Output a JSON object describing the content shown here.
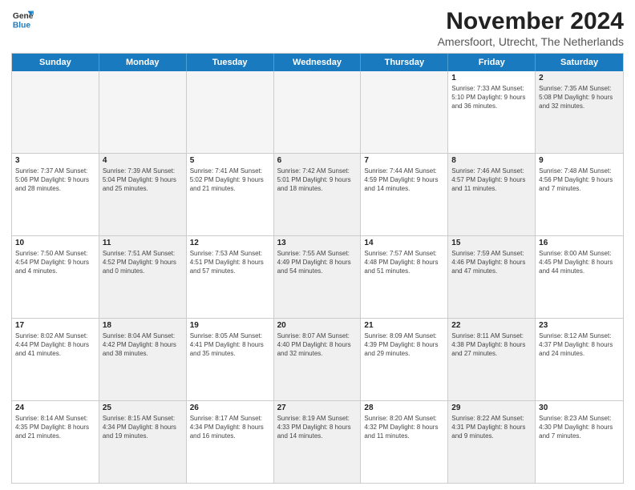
{
  "header": {
    "logo_line1": "General",
    "logo_line2": "Blue",
    "title": "November 2024",
    "subtitle": "Amersfoort, Utrecht, The Netherlands"
  },
  "weekdays": [
    "Sunday",
    "Monday",
    "Tuesday",
    "Wednesday",
    "Thursday",
    "Friday",
    "Saturday"
  ],
  "weeks": [
    [
      {
        "day": "",
        "info": "",
        "shaded": true
      },
      {
        "day": "",
        "info": "",
        "shaded": true
      },
      {
        "day": "",
        "info": "",
        "shaded": true
      },
      {
        "day": "",
        "info": "",
        "shaded": true
      },
      {
        "day": "",
        "info": "",
        "shaded": true
      },
      {
        "day": "1",
        "info": "Sunrise: 7:33 AM\nSunset: 5:10 PM\nDaylight: 9 hours and 36 minutes."
      },
      {
        "day": "2",
        "info": "Sunrise: 7:35 AM\nSunset: 5:08 PM\nDaylight: 9 hours and 32 minutes.",
        "shaded": true
      }
    ],
    [
      {
        "day": "3",
        "info": "Sunrise: 7:37 AM\nSunset: 5:06 PM\nDaylight: 9 hours and 28 minutes."
      },
      {
        "day": "4",
        "info": "Sunrise: 7:39 AM\nSunset: 5:04 PM\nDaylight: 9 hours and 25 minutes.",
        "shaded": true
      },
      {
        "day": "5",
        "info": "Sunrise: 7:41 AM\nSunset: 5:02 PM\nDaylight: 9 hours and 21 minutes."
      },
      {
        "day": "6",
        "info": "Sunrise: 7:42 AM\nSunset: 5:01 PM\nDaylight: 9 hours and 18 minutes.",
        "shaded": true
      },
      {
        "day": "7",
        "info": "Sunrise: 7:44 AM\nSunset: 4:59 PM\nDaylight: 9 hours and 14 minutes."
      },
      {
        "day": "8",
        "info": "Sunrise: 7:46 AM\nSunset: 4:57 PM\nDaylight: 9 hours and 11 minutes.",
        "shaded": true
      },
      {
        "day": "9",
        "info": "Sunrise: 7:48 AM\nSunset: 4:56 PM\nDaylight: 9 hours and 7 minutes."
      }
    ],
    [
      {
        "day": "10",
        "info": "Sunrise: 7:50 AM\nSunset: 4:54 PM\nDaylight: 9 hours and 4 minutes."
      },
      {
        "day": "11",
        "info": "Sunrise: 7:51 AM\nSunset: 4:52 PM\nDaylight: 9 hours and 0 minutes.",
        "shaded": true
      },
      {
        "day": "12",
        "info": "Sunrise: 7:53 AM\nSunset: 4:51 PM\nDaylight: 8 hours and 57 minutes."
      },
      {
        "day": "13",
        "info": "Sunrise: 7:55 AM\nSunset: 4:49 PM\nDaylight: 8 hours and 54 minutes.",
        "shaded": true
      },
      {
        "day": "14",
        "info": "Sunrise: 7:57 AM\nSunset: 4:48 PM\nDaylight: 8 hours and 51 minutes."
      },
      {
        "day": "15",
        "info": "Sunrise: 7:59 AM\nSunset: 4:46 PM\nDaylight: 8 hours and 47 minutes.",
        "shaded": true
      },
      {
        "day": "16",
        "info": "Sunrise: 8:00 AM\nSunset: 4:45 PM\nDaylight: 8 hours and 44 minutes."
      }
    ],
    [
      {
        "day": "17",
        "info": "Sunrise: 8:02 AM\nSunset: 4:44 PM\nDaylight: 8 hours and 41 minutes."
      },
      {
        "day": "18",
        "info": "Sunrise: 8:04 AM\nSunset: 4:42 PM\nDaylight: 8 hours and 38 minutes.",
        "shaded": true
      },
      {
        "day": "19",
        "info": "Sunrise: 8:05 AM\nSunset: 4:41 PM\nDaylight: 8 hours and 35 minutes."
      },
      {
        "day": "20",
        "info": "Sunrise: 8:07 AM\nSunset: 4:40 PM\nDaylight: 8 hours and 32 minutes.",
        "shaded": true
      },
      {
        "day": "21",
        "info": "Sunrise: 8:09 AM\nSunset: 4:39 PM\nDaylight: 8 hours and 29 minutes."
      },
      {
        "day": "22",
        "info": "Sunrise: 8:11 AM\nSunset: 4:38 PM\nDaylight: 8 hours and 27 minutes.",
        "shaded": true
      },
      {
        "day": "23",
        "info": "Sunrise: 8:12 AM\nSunset: 4:37 PM\nDaylight: 8 hours and 24 minutes."
      }
    ],
    [
      {
        "day": "24",
        "info": "Sunrise: 8:14 AM\nSunset: 4:35 PM\nDaylight: 8 hours and 21 minutes."
      },
      {
        "day": "25",
        "info": "Sunrise: 8:15 AM\nSunset: 4:34 PM\nDaylight: 8 hours and 19 minutes.",
        "shaded": true
      },
      {
        "day": "26",
        "info": "Sunrise: 8:17 AM\nSunset: 4:34 PM\nDaylight: 8 hours and 16 minutes."
      },
      {
        "day": "27",
        "info": "Sunrise: 8:19 AM\nSunset: 4:33 PM\nDaylight: 8 hours and 14 minutes.",
        "shaded": true
      },
      {
        "day": "28",
        "info": "Sunrise: 8:20 AM\nSunset: 4:32 PM\nDaylight: 8 hours and 11 minutes."
      },
      {
        "day": "29",
        "info": "Sunrise: 8:22 AM\nSunset: 4:31 PM\nDaylight: 8 hours and 9 minutes.",
        "shaded": true
      },
      {
        "day": "30",
        "info": "Sunrise: 8:23 AM\nSunset: 4:30 PM\nDaylight: 8 hours and 7 minutes."
      }
    ]
  ]
}
